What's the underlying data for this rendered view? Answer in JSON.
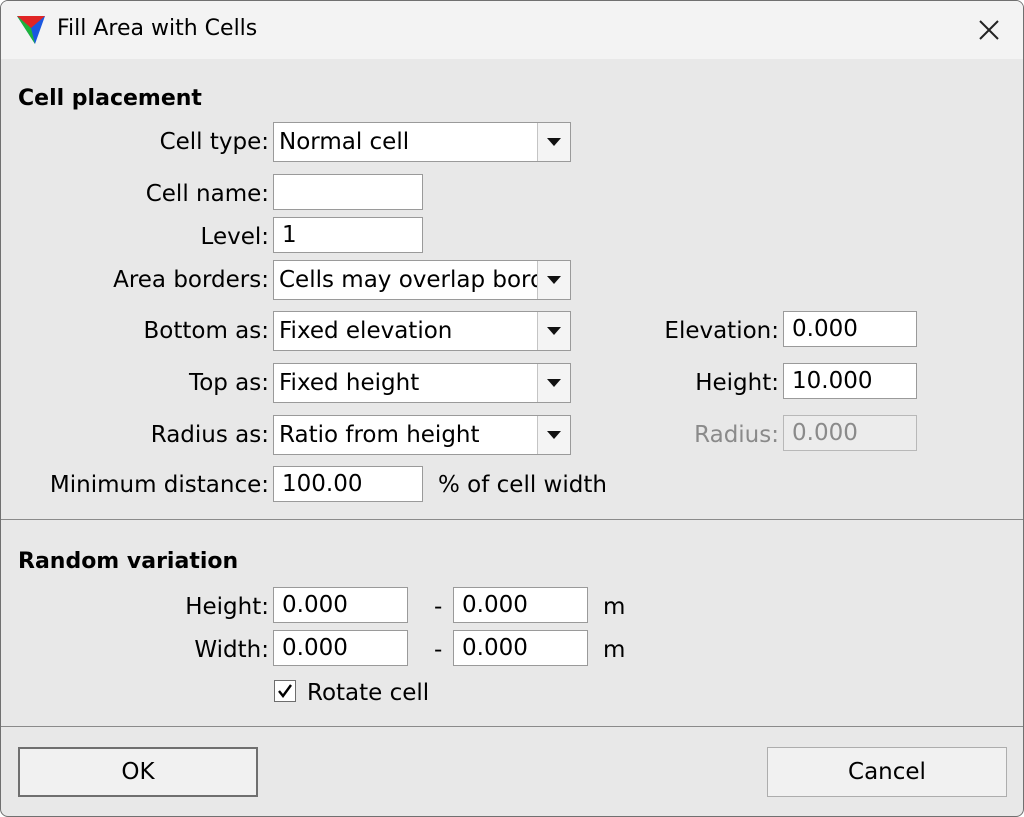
{
  "window": {
    "title": "Fill Area with Cells"
  },
  "placement": {
    "heading": "Cell placement",
    "cell_type": {
      "label": "Cell type:",
      "value": "Normal cell"
    },
    "cell_name": {
      "label": "Cell name:",
      "value": ""
    },
    "level": {
      "label": "Level:",
      "value": "1"
    },
    "area_borders": {
      "label": "Area borders:",
      "value": "Cells may overlap borders"
    },
    "bottom_as": {
      "label": "Bottom as:",
      "value": "Fixed elevation"
    },
    "elevation": {
      "label": "Elevation:",
      "value": "0.000"
    },
    "top_as": {
      "label": "Top as:",
      "value": "Fixed height"
    },
    "height": {
      "label": "Height:",
      "value": "10.000"
    },
    "radius_as": {
      "label": "Radius as:",
      "value": "Ratio from height"
    },
    "radius": {
      "label": "Radius:",
      "value": "0.000"
    },
    "min_distance": {
      "label": "Minimum distance:",
      "value": "100.00",
      "unit": "% of cell width"
    }
  },
  "random": {
    "heading": "Random variation",
    "height": {
      "label": "Height:",
      "from": "0.000",
      "to": "0.000",
      "dash": "-",
      "unit": "m"
    },
    "width": {
      "label": "Width:",
      "from": "0.000",
      "to": "0.000",
      "dash": "-",
      "unit": "m"
    },
    "rotate": {
      "label": "Rotate cell",
      "checked": true
    }
  },
  "buttons": {
    "ok": "OK",
    "cancel": "Cancel"
  },
  "icons": {
    "app": "colored-triangle-icon",
    "close": "close-icon",
    "dropdown": "chevron-down-icon",
    "check": "checkmark-icon"
  }
}
